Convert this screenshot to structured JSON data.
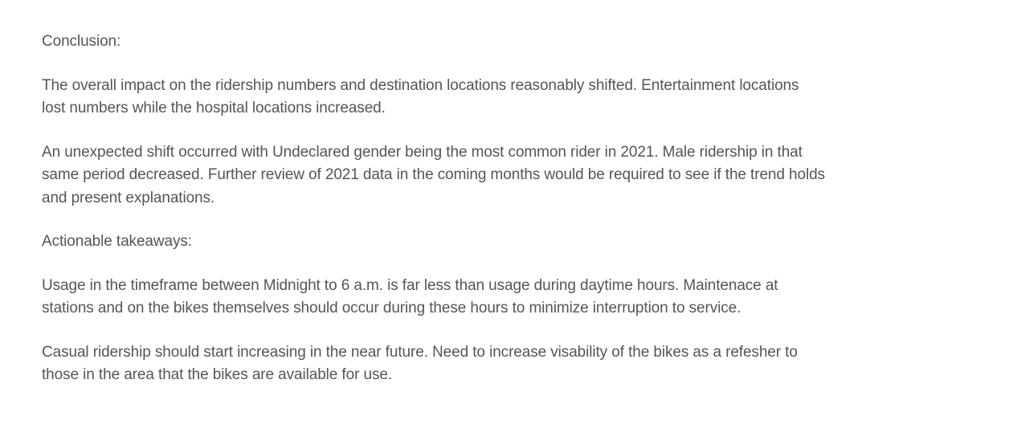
{
  "paragraphs": [
    {
      "lines": [
        "Conclusion:"
      ]
    },
    {
      "lines": [
        "The overall impact on the ridership numbers and destination locations reasonably shifted.  Entertainment locations",
        "lost numbers while the hospital locations increased."
      ]
    },
    {
      "lines": [
        "An unexpected shift occurred with Undeclared gender being the most common rider in 2021.  Male ridership in that",
        "same period decreased.  Further review of 2021 data in the coming months would be required to see if the trend holds",
        "and present explanations."
      ]
    },
    {
      "lines": [
        "Actionable takeaways:"
      ]
    },
    {
      "lines": [
        "Usage in the timeframe between Midnight to 6 a.m. is far less than usage during daytime hours.  Maintenace at",
        "stations and on the bikes themselves should occur during these hours to minimize interruption to service."
      ]
    },
    {
      "lines": [
        "Casual ridership should start increasing in the near future.  Need to increase visability of the bikes as a refesher to",
        "those in the area that the bikes are available for use."
      ]
    }
  ]
}
